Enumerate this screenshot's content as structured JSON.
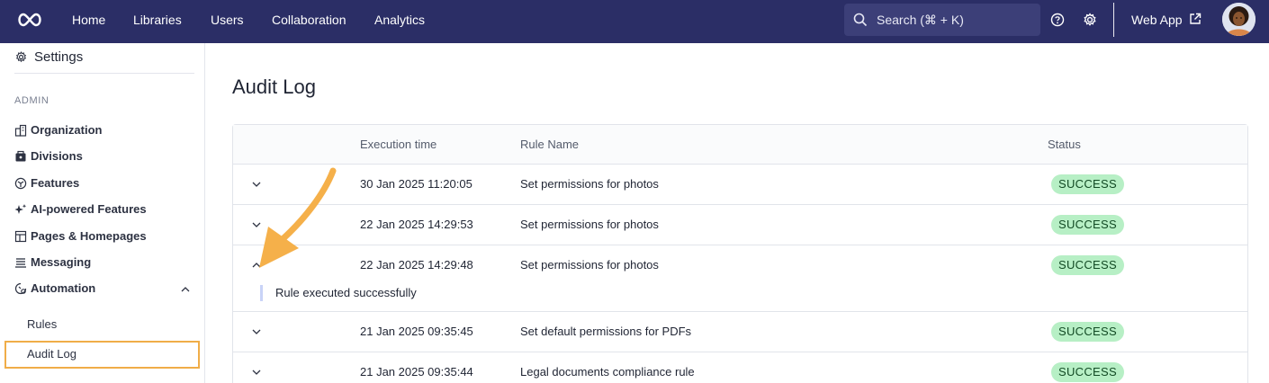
{
  "topbar": {
    "logo_icon": "infinity-logo-icon",
    "nav": [
      "Home",
      "Libraries",
      "Users",
      "Collaboration",
      "Analytics"
    ],
    "search_label": "Search (⌘ + K)",
    "web_app_label": "Web App",
    "colors": {
      "background": "#2b2e66",
      "search_bg": "#3c3f78"
    }
  },
  "sidebar": {
    "title": "Settings",
    "section": "ADMIN",
    "items": [
      {
        "label": "Organization",
        "icon": "building-icon"
      },
      {
        "label": "Divisions",
        "icon": "divisions-icon"
      },
      {
        "label": "Features",
        "icon": "features-icon"
      },
      {
        "label": "AI-powered Features",
        "icon": "sparkle-icon"
      },
      {
        "label": "Pages & Homepages",
        "icon": "pages-icon"
      },
      {
        "label": "Messaging",
        "icon": "messaging-icon"
      },
      {
        "label": "Automation",
        "icon": "automation-icon"
      }
    ],
    "subitems": [
      "Rules",
      "Audit Log"
    ],
    "active_subitem": "Audit Log",
    "highlight_color": "#f0ad48"
  },
  "main": {
    "title": "Audit Log",
    "columns": {
      "time": "Execution time",
      "rule": "Rule Name",
      "status": "Status"
    },
    "rows": [
      {
        "time": "30 Jan 2025 11:20:05",
        "rule": "Set permissions for photos",
        "status": "SUCCESS",
        "expanded": false
      },
      {
        "time": "22 Jan 2025 14:29:53",
        "rule": "Set permissions for photos",
        "status": "SUCCESS",
        "expanded": false
      },
      {
        "time": "22 Jan 2025 14:29:48",
        "rule": "Set permissions for photos",
        "status": "SUCCESS",
        "expanded": true,
        "detail": "Rule executed successfully"
      },
      {
        "time": "21 Jan 2025 09:35:45",
        "rule": "Set default permissions for PDFs",
        "status": "SUCCESS",
        "expanded": false
      },
      {
        "time": "21 Jan 2025 09:35:44",
        "rule": "Legal documents compliance rule",
        "status": "SUCCESS",
        "expanded": false
      }
    ],
    "status_colors": {
      "success_bg": "#b7efc5",
      "success_text": "#134b25"
    }
  },
  "annotation": {
    "arrow_color": "#f5b04a"
  }
}
